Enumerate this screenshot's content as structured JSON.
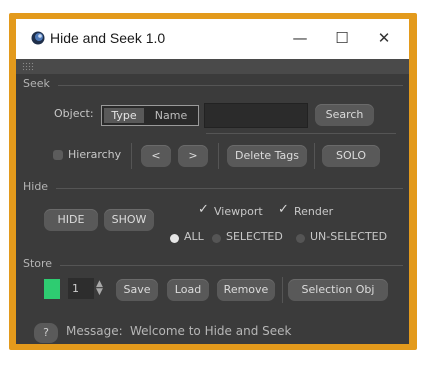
{
  "window": {
    "title": "Hide and Seek 1.0",
    "minimize_glyph": "—",
    "maximize_glyph": "☐",
    "close_glyph": "✕"
  },
  "seek": {
    "section_label": "Seek",
    "object_label": "Object:",
    "type_label": "Type",
    "name_label": "Name",
    "object_value": "",
    "search_label": "Search",
    "hierarchy_label": "Hierarchy",
    "prev_label": "<",
    "next_label": ">",
    "delete_tags_label": "Delete Tags",
    "solo_label": "SOLO"
  },
  "hide": {
    "section_label": "Hide",
    "hide_label": "HIDE",
    "show_label": "SHOW",
    "viewport_label": "Viewport",
    "render_label": "Render",
    "all_label": "ALL",
    "selected_label": "SELECTED",
    "unselected_label": "UN-SELECTED"
  },
  "store": {
    "section_label": "Store",
    "swatch_color": "#2ecc71",
    "slot_value": "1",
    "save_label": "Save",
    "load_label": "Load",
    "remove_label": "Remove",
    "selection_obj_label": "Selection Obj"
  },
  "footer": {
    "help_label": "?",
    "message_label": "Message:",
    "message_text": "Welcome to Hide and Seek"
  },
  "colors": {
    "frame_border": "#e39a1c",
    "panel_bg": "#3b3b3b",
    "button_bg": "#595959",
    "swatch": "#2ecc71"
  }
}
